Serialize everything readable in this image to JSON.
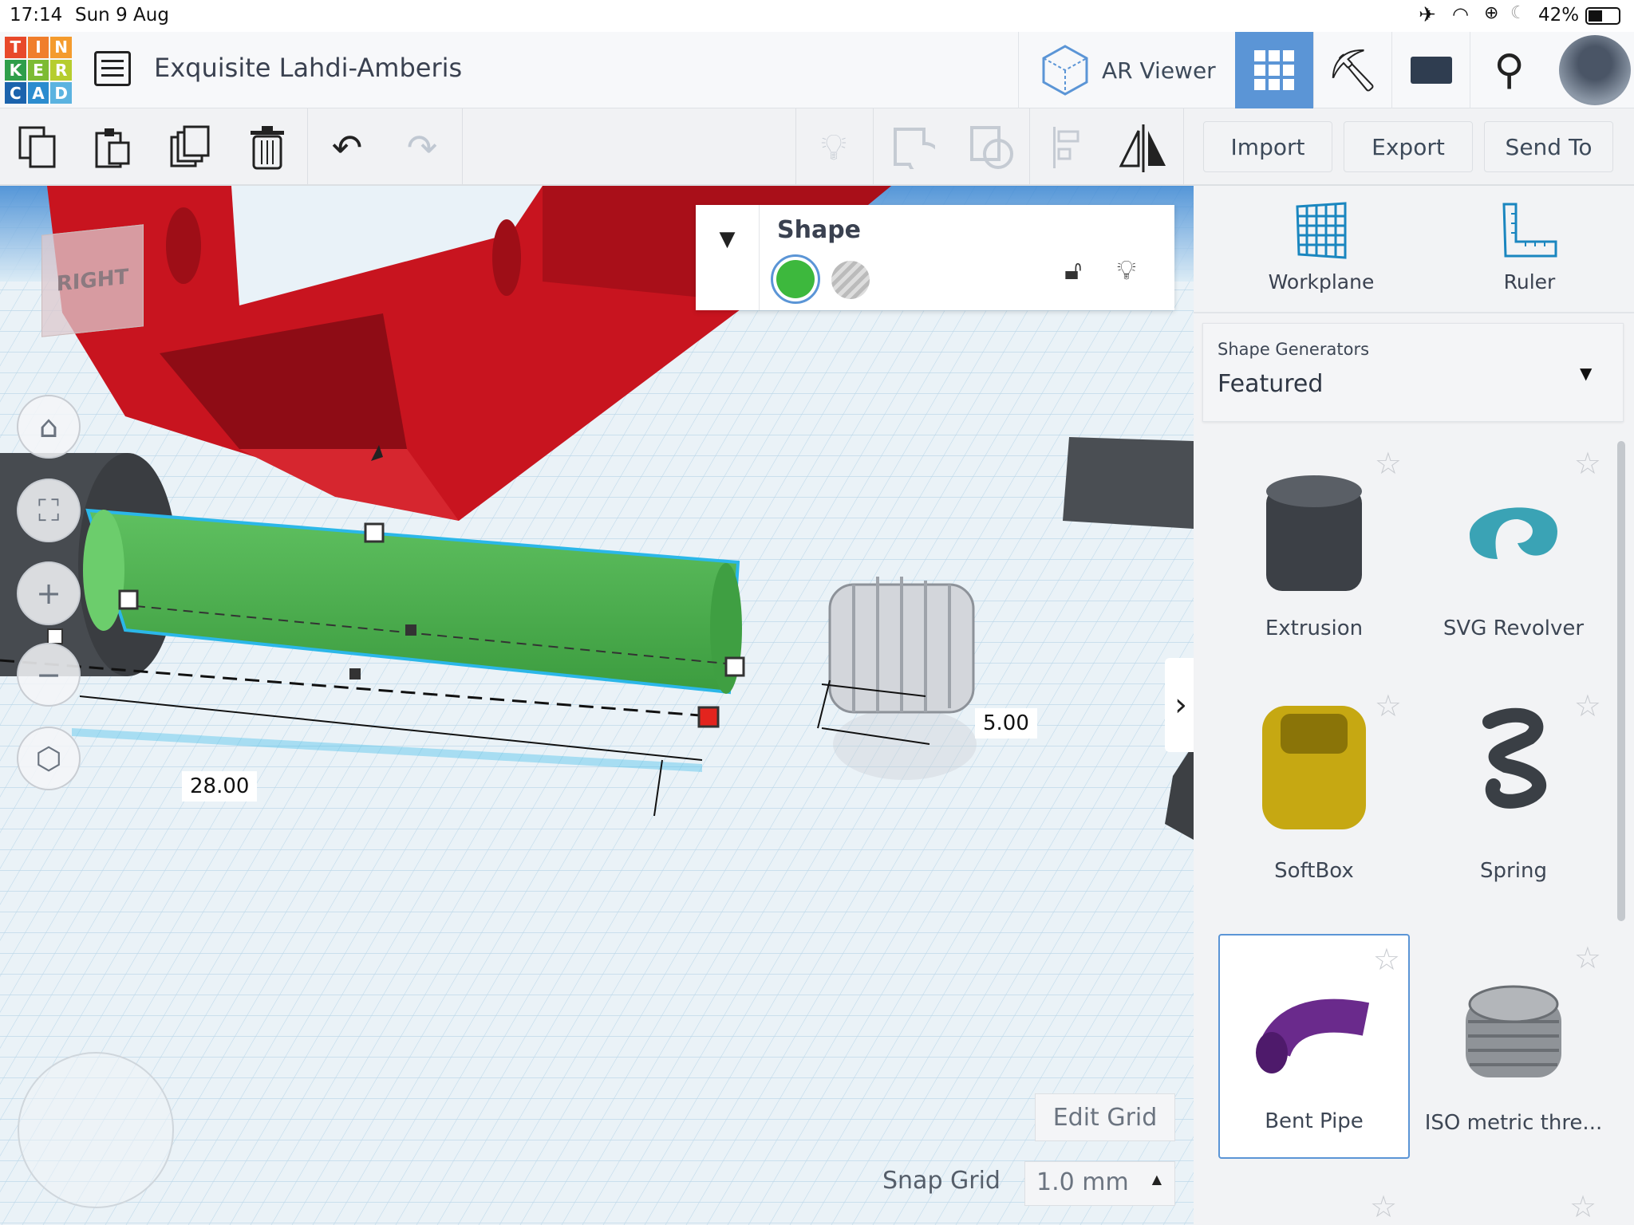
{
  "status_bar": {
    "time": "17:14",
    "date": "Sun 9 Aug",
    "battery": "42%"
  },
  "header": {
    "logo_letters": [
      "T",
      "I",
      "N",
      "K",
      "E",
      "R",
      "C",
      "A",
      "D"
    ],
    "project_title": "Exquisite Lahdi-Amberis",
    "ar_viewer_label": "AR Viewer",
    "active_view": "3d-design-grid"
  },
  "toolbar": {
    "import_label": "Import",
    "export_label": "Export",
    "send_to_label": "Send To"
  },
  "inspector": {
    "title": "Shape",
    "solid_color": "#3db83d"
  },
  "viewport": {
    "view_cube_label": "RIGHT",
    "dim_length": "28.00",
    "dim_height": "5.00",
    "edit_grid_label": "Edit Grid",
    "snap_grid_label": "Snap Grid",
    "snap_grid_value": "1.0 mm"
  },
  "right_panel": {
    "workplane_label": "Workplane",
    "ruler_label": "Ruler",
    "dropdown_caption": "Shape Generators",
    "dropdown_value": "Featured",
    "shapes": [
      {
        "label": "Extrusion"
      },
      {
        "label": "SVG Revolver"
      },
      {
        "label": "SoftBox"
      },
      {
        "label": "Spring"
      },
      {
        "label": "Bent Pipe",
        "selected": true
      },
      {
        "label": "ISO metric thre..."
      }
    ]
  },
  "colors": {
    "accent": "#5b95d6",
    "red_frame": "#c8141f",
    "green_shape": "#4caf50",
    "selection": "#2bb7e8"
  }
}
